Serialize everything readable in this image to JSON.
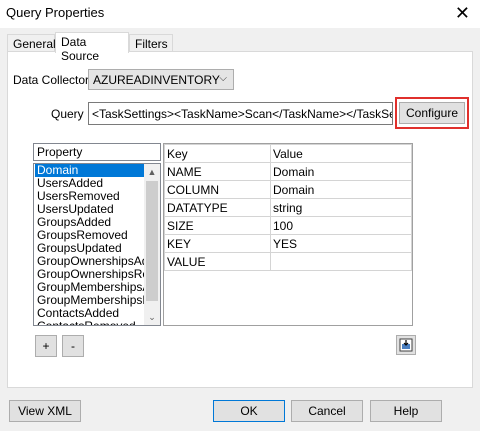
{
  "window": {
    "title": "Query Properties"
  },
  "tabs": [
    {
      "label": "General"
    },
    {
      "label": "Data Source"
    },
    {
      "label": "Filters"
    }
  ],
  "data_collector": {
    "label": "Data Collector",
    "value": "AZUREADINVENTORY"
  },
  "query": {
    "label": "Query",
    "value": "<TaskSettings><TaskName>Scan</TaskName></TaskSettings>"
  },
  "configure_label": "Configure",
  "property_list": {
    "header": "Property",
    "items": [
      "Domain",
      "UsersAdded",
      "UsersRemoved",
      "UsersUpdated",
      "GroupsAdded",
      "GroupsRemoved",
      "GroupsUpdated",
      "GroupOwnershipsAdded",
      "GroupOwnershipsRemoved",
      "GroupMembershipsAdded",
      "GroupMembershipsRemoved",
      "ContactsAdded",
      "ContactsRemoved"
    ],
    "selected": "Domain"
  },
  "key_value_grid": {
    "headers": {
      "key": "Key",
      "value": "Value"
    },
    "rows": [
      {
        "key": "NAME",
        "value": "Domain"
      },
      {
        "key": "COLUMN",
        "value": "Domain"
      },
      {
        "key": "DATATYPE",
        "value": "string"
      },
      {
        "key": "SIZE",
        "value": "100"
      },
      {
        "key": "KEY",
        "value": "YES"
      },
      {
        "key": "VALUE",
        "value": ""
      }
    ]
  },
  "add_label": "+",
  "remove_label": "-",
  "footer": {
    "view_xml": "View XML",
    "ok": "OK",
    "cancel": "Cancel",
    "help": "Help"
  },
  "colors": {
    "selection": "#0078d7",
    "highlight_border": "#e0302c"
  }
}
